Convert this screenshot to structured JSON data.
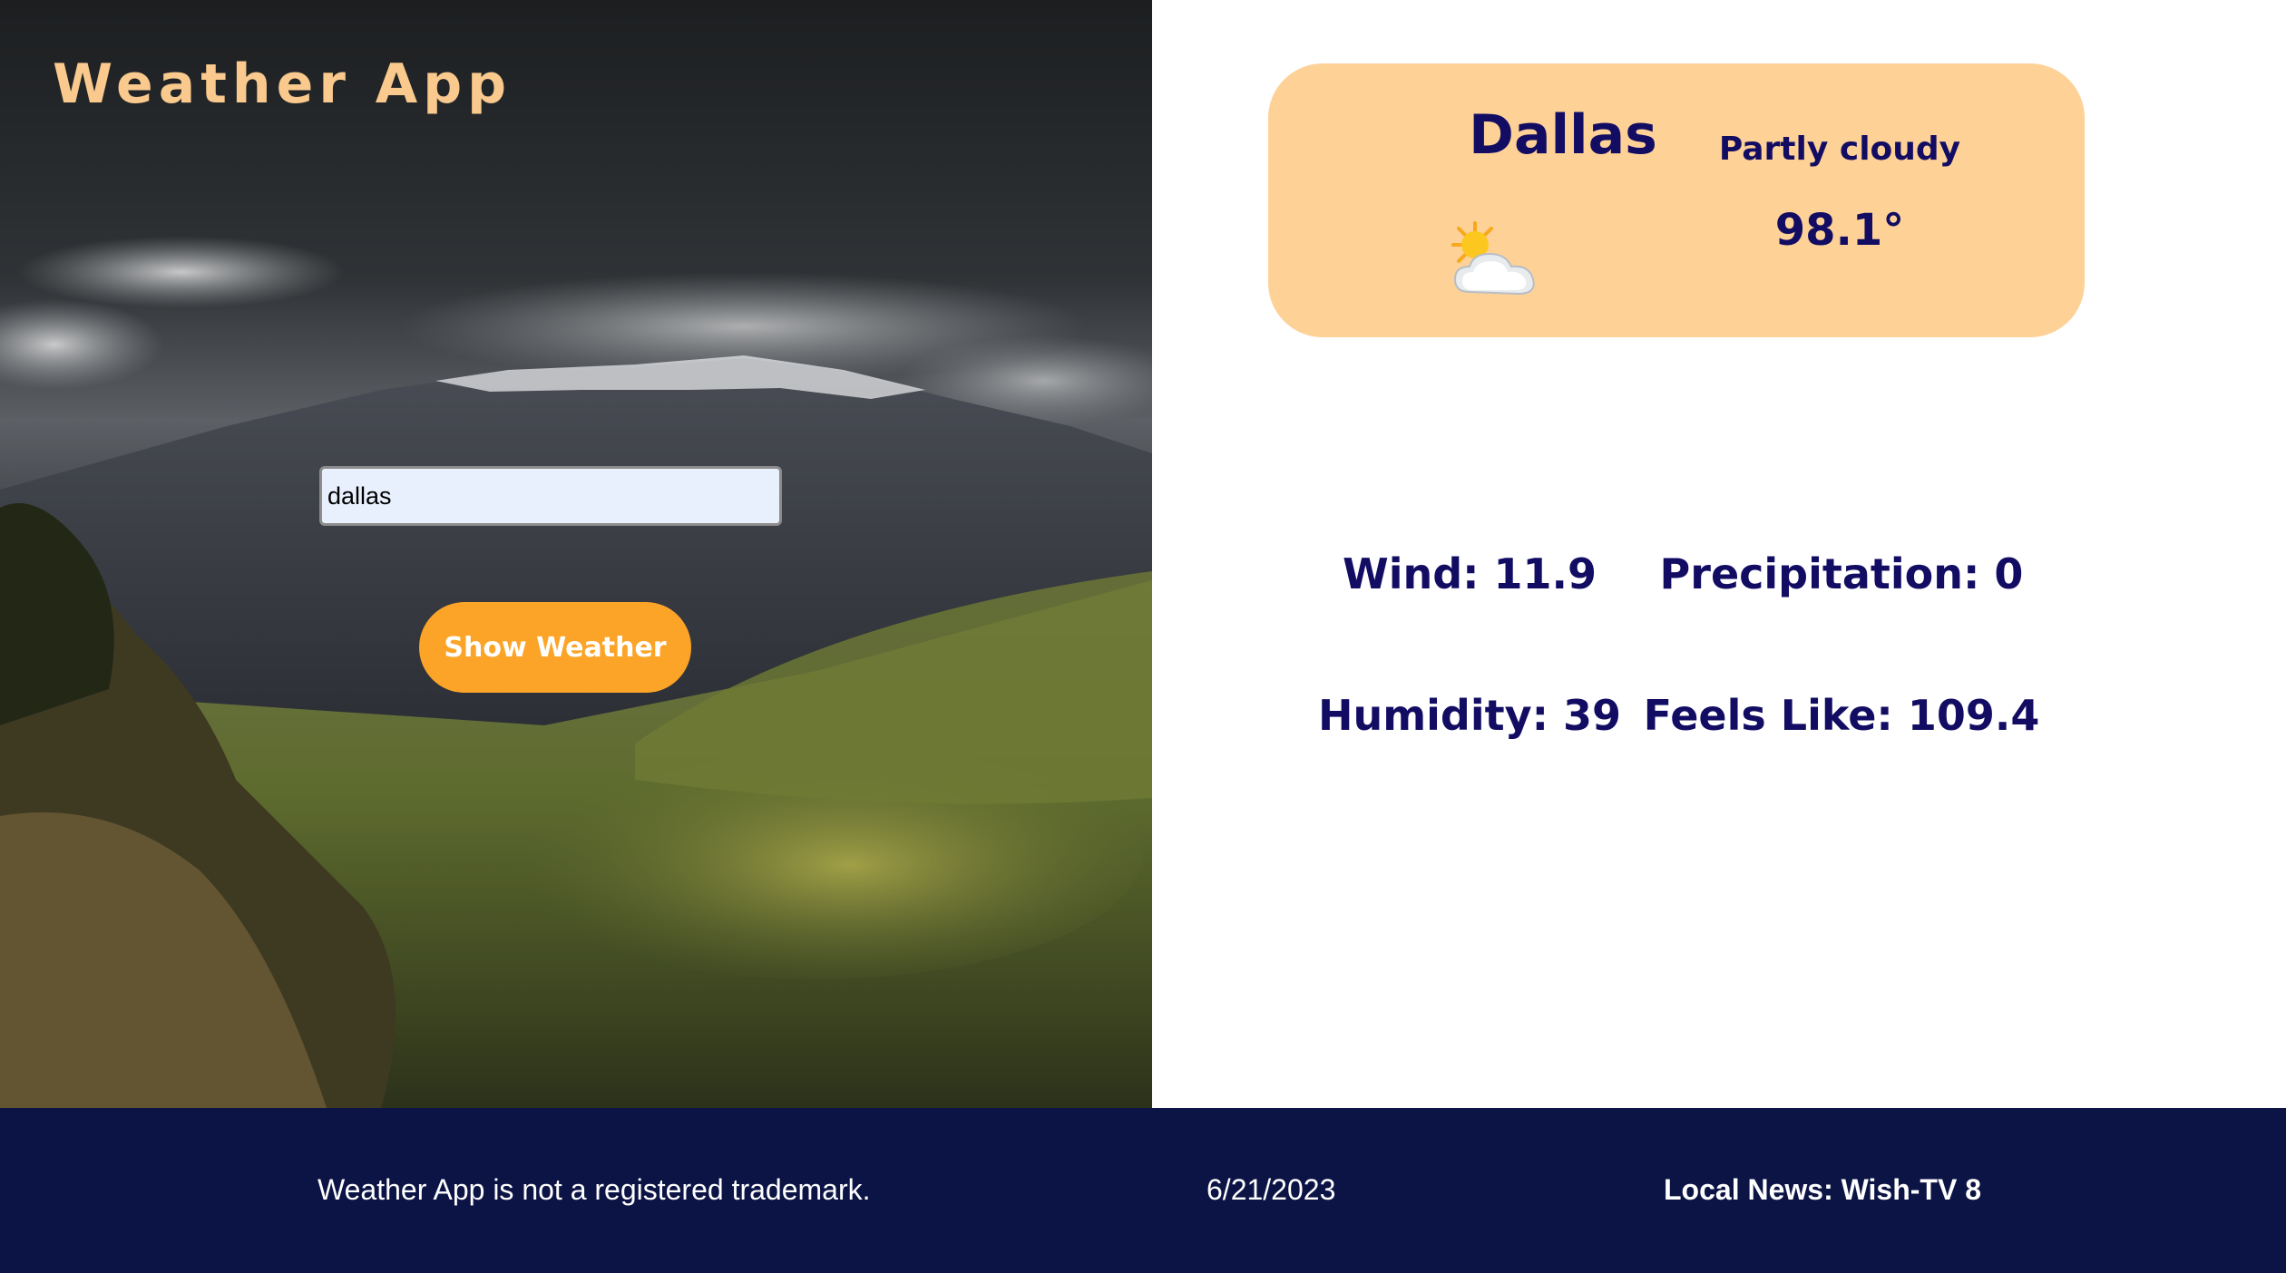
{
  "header": {
    "title": "Weather App"
  },
  "search": {
    "value": "dallas",
    "button_label": "Show Weather"
  },
  "weather": {
    "city": "Dallas",
    "condition": "Partly cloudy",
    "temperature": "98.1°",
    "icon": "partly-cloudy-icon"
  },
  "stats": {
    "wind": "Wind: 11.9",
    "precipitation": "Precipitation: 0",
    "humidity": "Humidity: 39",
    "feels_like": "Feels Like: 109.4"
  },
  "footer": {
    "trademark_note": "Weather App is not a registered trademark.",
    "date": "6/21/2023",
    "news": "Local News: Wish-TV 8"
  },
  "colors": {
    "accent_text": "#120d63",
    "card_bg": "#fed197",
    "button_bg": "#fca427",
    "title_color": "#f9c98d",
    "footer_bg": "#0c1445"
  }
}
